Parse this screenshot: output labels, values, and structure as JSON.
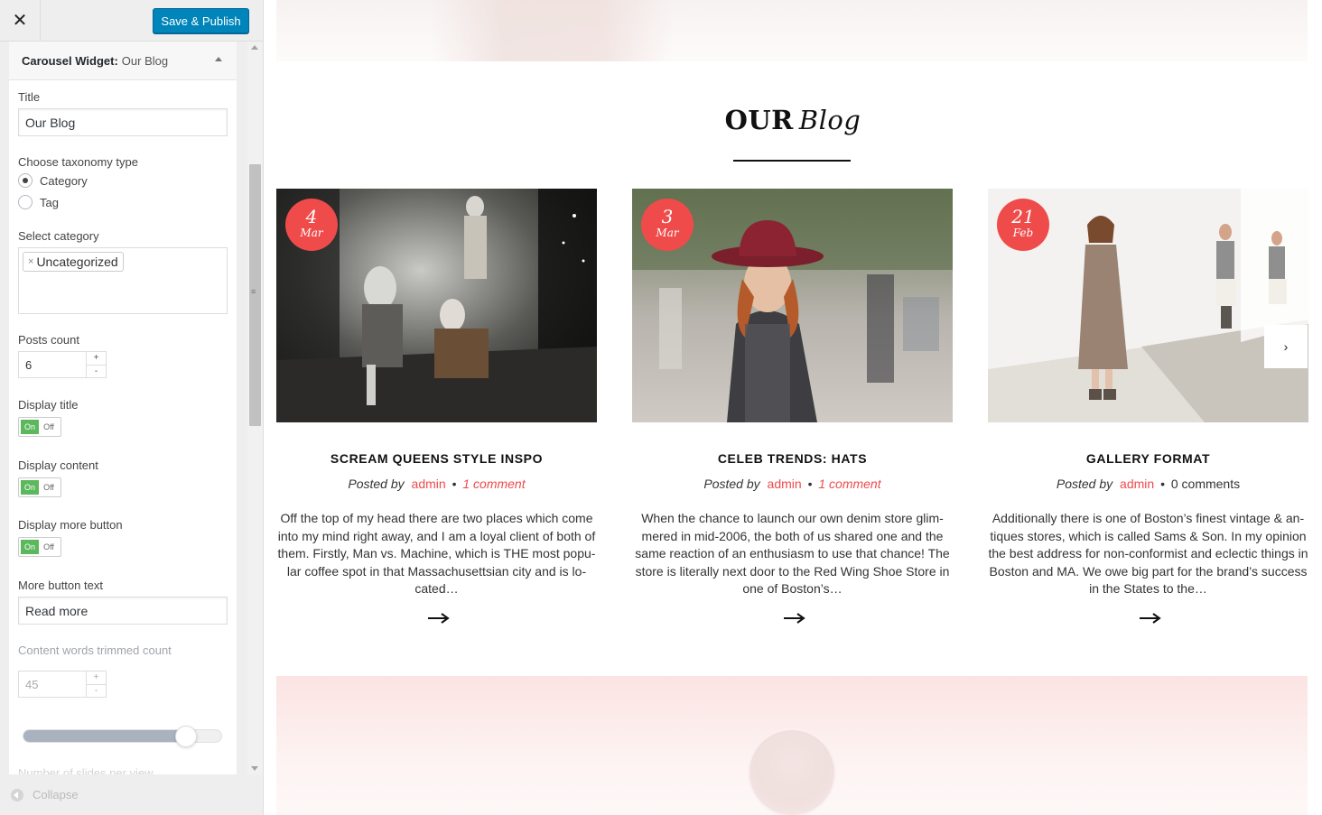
{
  "customizer": {
    "close_icon": "close-icon",
    "close_glyph": "✕",
    "publish_label": "Save & Publish",
    "widget_title": "Carousel Widget:",
    "widget_subtitle": "Our Blog",
    "title_label": "Title",
    "title_value": "Our Blog",
    "taxonomy_label": "Choose taxonomy type",
    "taxonomy_options": [
      "Category",
      "Tag"
    ],
    "taxonomy_selected": "Category",
    "category_label": "Select category",
    "category_chip": "Uncategorized",
    "chip_remove": "×",
    "posts_count_label": "Posts count",
    "posts_count_value": "6",
    "spinner_plus": "+",
    "spinner_minus": "-",
    "display_title_label": "Display title",
    "display_content_label": "Display content",
    "display_more_label": "Display more button",
    "toggle_on": "On",
    "toggle_off": "Off",
    "more_text_label": "More button text",
    "more_text_value": "Read more",
    "trim_label": "Content words trimmed count",
    "trim_value": "45",
    "trim_slider_fraction": 0.82,
    "slides_label": "Number of slides per view",
    "collapse_label": "Collapse",
    "scroll_grip": "≡"
  },
  "preview": {
    "section_title_bold": "OUR",
    "section_title_italic": "Blog",
    "next_glyph": "›",
    "posts": [
      {
        "day": "4",
        "month": "Mar",
        "title": "SCREAM QUEENS STYLE INSPO",
        "posted_by": "Posted by",
        "author": "admin",
        "separator": "•",
        "comments": "1 comment",
        "excerpt": "Off the top of my head there are two places which come into my mind right away, and I am a loyal client of both of them. Firstly, Man vs. Machine, which is THE most popu-lar coffee spot in that Massachusettsian city and is lo-cated…"
      },
      {
        "day": "3",
        "month": "Mar",
        "title": "CELEB TRENDS: HATS",
        "posted_by": "Posted by",
        "author": "admin",
        "separator": "•",
        "comments": "1 comment",
        "excerpt": "When the chance to launch our own denim store glim-mered in mid-2006, the both of us shared one and the same reaction of an enthusiasm to use that chance! The store is literally next door to the Red Wing Shoe Store in one of Boston’s…"
      },
      {
        "day": "21",
        "month": "Feb",
        "title": "GALLERY FORMAT",
        "posted_by": "Posted by",
        "author": "admin",
        "separator": "•",
        "comments": "0 comments",
        "excerpt": "Additionally there is one of Boston’s finest vintage & an-tiques stores, which is called Sams & Son. In my opinion the best address for non-conformist and eclectic things in Boston and MA. We owe big part for the brand’s success in the States to the…"
      }
    ]
  },
  "colors": {
    "accent": "#ef4b4b",
    "publish": "#0085ba",
    "toggle_on": "#5cb85c"
  }
}
